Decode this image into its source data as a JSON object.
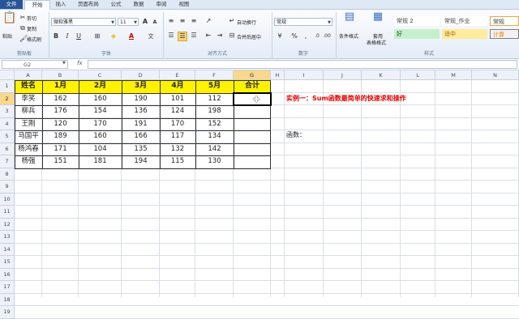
{
  "tabs": [
    "文件",
    "开始",
    "插入",
    "页面布局",
    "公式",
    "数据",
    "审阅",
    "视图"
  ],
  "clipboard": {
    "cut": "剪切",
    "copy": "复制",
    "paste": "粘贴",
    "format_painter": "格式刷",
    "group": "剪贴板"
  },
  "font": {
    "name": "微软雅黑",
    "size": "11",
    "group": "字体",
    "bold": "B",
    "italic": "I",
    "underline": "U",
    "grow": "A",
    "shrink": "A",
    "color_a": "A",
    "wen": "文"
  },
  "alignment": {
    "wrap": "自动换行",
    "merge": "合并后居中",
    "group": "对齐方式"
  },
  "number": {
    "format": "常规",
    "percent": "%",
    "comma": ",",
    "group": "数字"
  },
  "styles": {
    "cond_format": "条件格式",
    "table_format_1": "套用",
    "table_format_2": "表格格式",
    "group": "样式",
    "cells": [
      {
        "label": "常规 2",
        "bg": "#ffffff",
        "fg": "#333333"
      },
      {
        "label": "常规_作业",
        "bg": "#ffffff",
        "fg": "#333333"
      },
      {
        "label": "常规",
        "bg": "#ffffff",
        "fg": "#333333"
      },
      {
        "label": "好",
        "bg": "#c6efce",
        "fg": "#006100"
      },
      {
        "label": "适中",
        "bg": "#ffeb9c",
        "fg": "#9c6500"
      },
      {
        "label": "计算",
        "bg": "#f2f2f2",
        "fg": "#fa7d00"
      }
    ]
  },
  "formula_bar": {
    "name_box": "G2",
    "fx": "fx"
  },
  "columns": [
    "A",
    "B",
    "C",
    "D",
    "E",
    "F",
    "G",
    "H",
    "I",
    "J",
    "K",
    "L",
    "M",
    "N"
  ],
  "rows": [
    "1",
    "2",
    "3",
    "4",
    "5",
    "6",
    "7",
    "8",
    "9",
    "10",
    "11",
    "12",
    "13",
    "14",
    "15",
    "16",
    "17",
    "18",
    "19"
  ],
  "table": {
    "headers": [
      "姓名",
      "1月",
      "2月",
      "3月",
      "4月",
      "5月",
      "合计"
    ],
    "data": [
      [
        "李笑",
        "162",
        "160",
        "190",
        "101",
        "112",
        ""
      ],
      [
        "柳兵",
        "176",
        "154",
        "136",
        "124",
        "198",
        ""
      ],
      [
        "王刚",
        "120",
        "170",
        "191",
        "170",
        "152",
        ""
      ],
      [
        "马国平",
        "189",
        "160",
        "166",
        "117",
        "134",
        ""
      ],
      [
        "杨鸿春",
        "171",
        "104",
        "135",
        "132",
        "142",
        ""
      ],
      [
        "杨强",
        "151",
        "181",
        "194",
        "115",
        "130",
        ""
      ]
    ]
  },
  "notes": {
    "title": "实例一：Sum函数最简单的快速求和操作",
    "function_label": "函数：",
    "title_color": "#e00000"
  },
  "selected_cell": "G2"
}
